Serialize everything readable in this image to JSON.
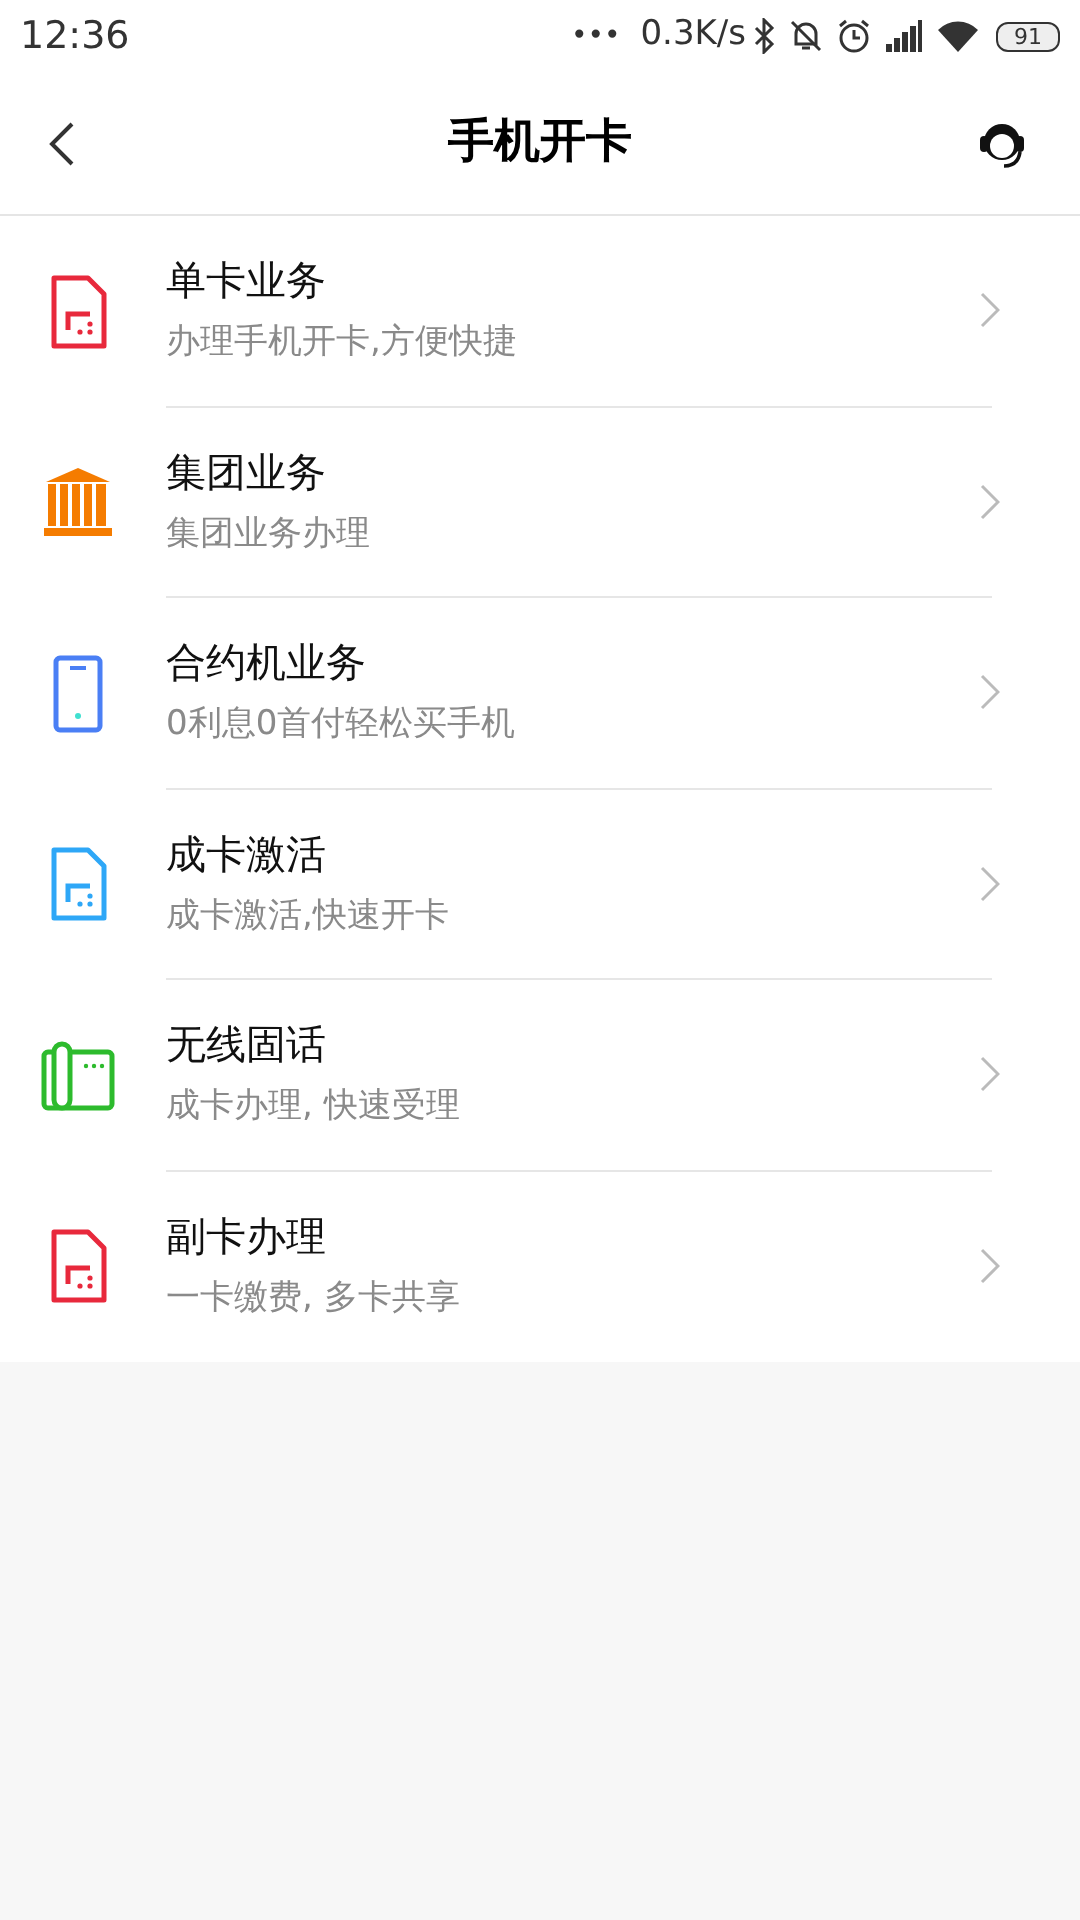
{
  "status_bar": {
    "time": "12:36",
    "dots": "•••",
    "speed": "0.3K/s",
    "battery": "91"
  },
  "header": {
    "title": "手机开卡"
  },
  "items": [
    {
      "kind": "sim",
      "color": "#e8293c",
      "title": "单卡业务",
      "subtitle": "办理手机开卡,方便快捷"
    },
    {
      "kind": "bank",
      "color": "#f57c00",
      "title": "集团业务",
      "subtitle": "集团业务办理"
    },
    {
      "kind": "phone",
      "color": "#4a7ff5",
      "title": "合约机业务",
      "subtitle": "0利息0首付轻松买手机"
    },
    {
      "kind": "sim",
      "color": "#2ea7f7",
      "title": "成卡激活",
      "subtitle": "成卡激活,快速开卡"
    },
    {
      "kind": "landline",
      "color": "#2dbb2d",
      "title": "无线固话",
      "subtitle": "成卡办理, 快速受理"
    },
    {
      "kind": "sim",
      "color": "#e8293c",
      "title": "副卡办理",
      "subtitle": "一卡缴费, 多卡共享"
    }
  ]
}
